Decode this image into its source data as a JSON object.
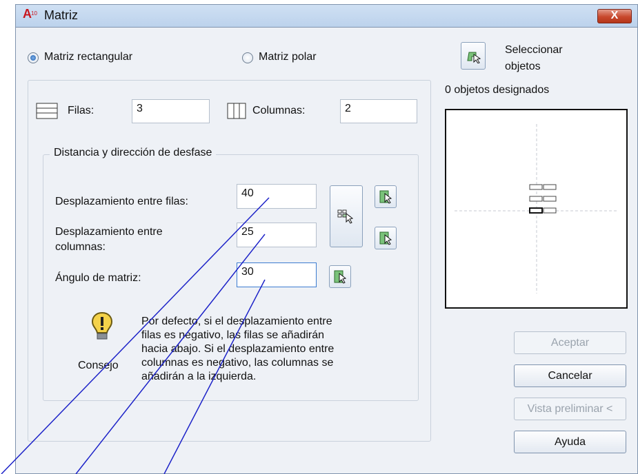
{
  "window": {
    "title": "Matriz",
    "close_label": "X"
  },
  "modes": {
    "rectangular": "Matriz rectangular",
    "polar": "Matriz polar",
    "selected": "rectangular"
  },
  "select_objects": {
    "label_line1": "Seleccionar",
    "label_line2": "objetos",
    "status": "0 objetos designados"
  },
  "grid": {
    "rows_label": "Filas:",
    "rows_value": "3",
    "cols_label": "Columnas:",
    "cols_value": "2"
  },
  "offset": {
    "group_label": "Distancia y dirección de desfase",
    "row_offset_label": "Desplazamiento entre filas:",
    "row_offset_value": "40",
    "col_offset_label_line1": "Desplazamiento entre",
    "col_offset_label_line2": "columnas:",
    "col_offset_value": "25",
    "angle_label": "Ángulo de matriz:",
    "angle_value": "30"
  },
  "tip": {
    "title": "Consejo",
    "lines": [
      "Por defecto, si el desplazamiento entre",
      "filas es negativo, las filas se añadirán",
      "hacia abajo. Si el desplazamiento entre",
      "columnas es negativo, las columnas se",
      "añadirán a la izquierda."
    ]
  },
  "buttons": {
    "ok": "Aceptar",
    "cancel": "Cancelar",
    "preview": "Vista preliminar <",
    "help": "Ayuda"
  },
  "icons": {
    "app": "autocad-app-icon",
    "select": "select-objects-icon",
    "rows": "rows-icon",
    "cols": "columns-icon",
    "pick_both": "pick-both-offsets-icon",
    "pick_row": "pick-row-offset-icon",
    "pick_col": "pick-column-offset-icon",
    "pick_angle": "pick-angle-icon",
    "tip": "lightbulb-icon"
  },
  "colors": {
    "title_bar": "#c5d8ef",
    "close_button": "#c8482d",
    "annotation_line": "#1c22c8"
  }
}
